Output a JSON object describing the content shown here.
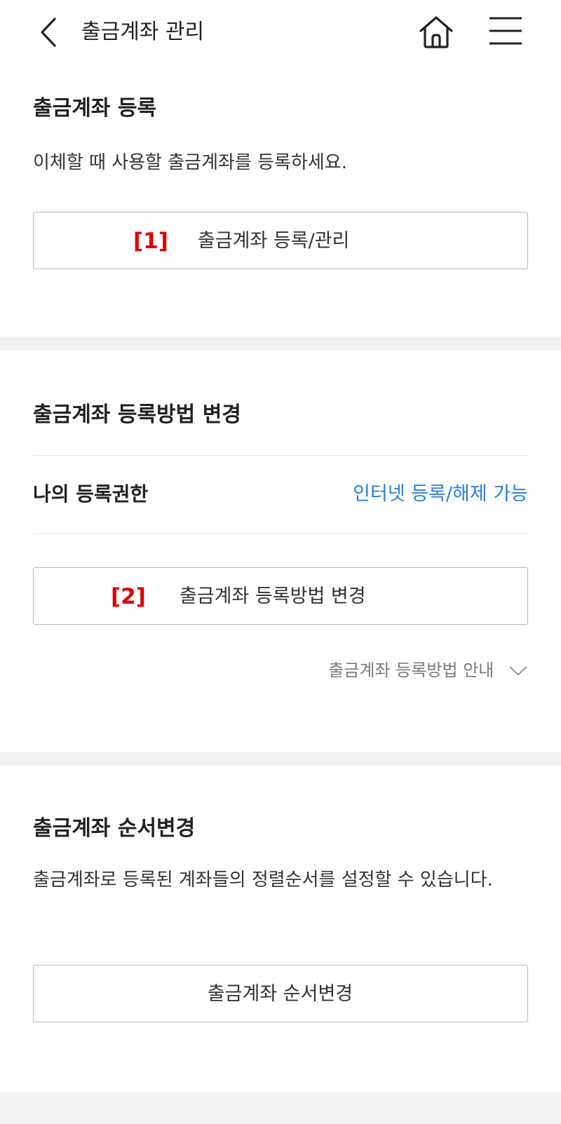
{
  "header": {
    "title": "출금계좌 관리",
    "back_icon": "chevron-left-icon",
    "home_icon": "home-icon",
    "menu_icon": "hamburger-menu-icon"
  },
  "register": {
    "title": "출금계좌 등록",
    "description": "이체할 때 사용할 출금계좌를 등록하세요.",
    "button_annotation": "[1]",
    "button_label": "출금계좌 등록/관리"
  },
  "method": {
    "title": "출금계좌 등록방법 변경",
    "authority_label": "나의 등록권한",
    "authority_value": "인터넷 등록/해제 가능",
    "button_annotation": "[2]",
    "button_label": "출금계좌 등록방법 변경",
    "guide_label": "출금계좌 등록방법 안내"
  },
  "order": {
    "title": "출금계좌 순서변경",
    "description": "출금계좌로 등록된 계좌들의 정렬순서를 설정할 수 있습니다.",
    "button_label": "출금계좌 순서변경"
  },
  "colors": {
    "accent_link": "#2d7fd3",
    "annotation": "#e00000",
    "section_gap": "#f2f2f3"
  }
}
